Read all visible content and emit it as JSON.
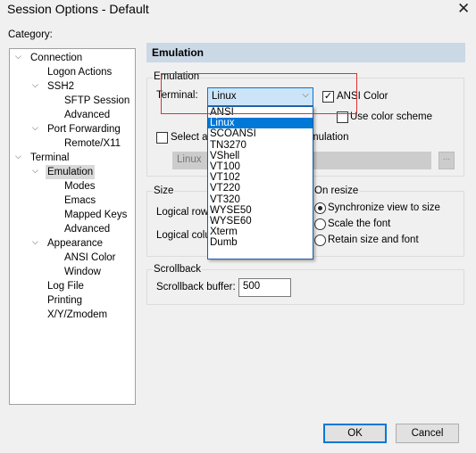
{
  "window": {
    "title": "Session Options - Default",
    "close_icon": "close-icon"
  },
  "category_label": "Category:",
  "tree": [
    {
      "label": "Connection",
      "expanded": true
    },
    {
      "label": "Logon Actions"
    },
    {
      "label": "SSH2",
      "expanded": true
    },
    {
      "label": "SFTP Session"
    },
    {
      "label": "Advanced"
    },
    {
      "label": "Port Forwarding",
      "expanded": true
    },
    {
      "label": "Remote/X11"
    },
    {
      "label": "Terminal",
      "expanded": true
    },
    {
      "label": "Emulation",
      "expanded": true,
      "selected": true
    },
    {
      "label": "Modes"
    },
    {
      "label": "Emacs"
    },
    {
      "label": "Mapped Keys"
    },
    {
      "label": "Advanced"
    },
    {
      "label": "Appearance",
      "expanded": true
    },
    {
      "label": "ANSI Color"
    },
    {
      "label": "Window"
    },
    {
      "label": "Log File"
    },
    {
      "label": "Printing"
    },
    {
      "label": "X/Y/Zmodem"
    }
  ],
  "panel": {
    "header": "Emulation",
    "emulation": {
      "group_label": "Emulation",
      "terminal_label": "Terminal:",
      "terminal_value": "Linux",
      "terminal_options": [
        "ANSI",
        "Linux",
        "SCOANSI",
        "TN3270",
        "VShell",
        "VT100",
        "VT102",
        "VT220",
        "VT320",
        "WYSE50",
        "WYSE60",
        "Xterm",
        "Dumb"
      ],
      "ansi_color_label": "ANSI Color",
      "ansi_color_checked": true,
      "use_color_scheme_label": "Use color scheme",
      "use_color_scheme_checked": false,
      "select_alt_label": "Select an alternate keyboard emulation",
      "select_alt_checked": false,
      "alt_value": "Linux",
      "browse_label": "..."
    },
    "size": {
      "group_label": "Size",
      "rows_label": "Logical rows:",
      "cols_label": "Logical columns:",
      "on_resize_label": "On resize",
      "options": [
        "Synchronize view to size",
        "Scale the font",
        "Retain size and font"
      ],
      "selected": 0
    },
    "scrollback": {
      "group_label": "Scrollback",
      "buffer_label": "Scrollback buffer:",
      "buffer_value": "500"
    }
  },
  "buttons": {
    "ok": "OK",
    "cancel": "Cancel"
  },
  "colors": {
    "accent": "#0078d7",
    "header_bg": "#cbd8e6",
    "highlight_box": "#e03030"
  }
}
